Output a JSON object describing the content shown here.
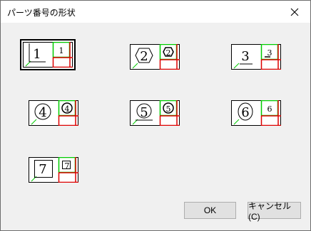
{
  "window": {
    "title": "パーツ番号の形状",
    "close_icon": "close-icon"
  },
  "shapes": [
    {
      "label": "1",
      "small_label": "1",
      "shape": "square",
      "selected": true
    },
    {
      "label": "2",
      "small_label": "2",
      "shape": "hexagon",
      "selected": false
    },
    {
      "label": "3",
      "small_label": "3",
      "shape": "underline",
      "selected": false
    },
    {
      "label": "4",
      "small_label": "4",
      "shape": "circle",
      "selected": false
    },
    {
      "label": "5",
      "small_label": "5",
      "shape": "circle-underline",
      "selected": false
    },
    {
      "label": "6",
      "small_label": "6",
      "shape": "ellipse",
      "selected": false
    },
    {
      "label": "7",
      "small_label": "7",
      "shape": "box",
      "selected": false
    }
  ],
  "buttons": {
    "ok": "OK",
    "cancel": "キャンセル(C)"
  },
  "colors": {
    "green": "#00cc00",
    "red": "#dd0000"
  }
}
